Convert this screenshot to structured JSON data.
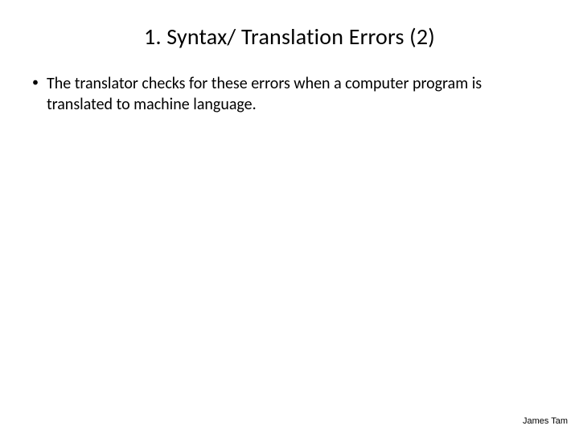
{
  "title": "1.  Syntax/ Translation Errors (2)",
  "bullets": [
    {
      "text": "The translator checks for these errors when a computer program is translated to machine language."
    }
  ],
  "footer": "James Tam"
}
